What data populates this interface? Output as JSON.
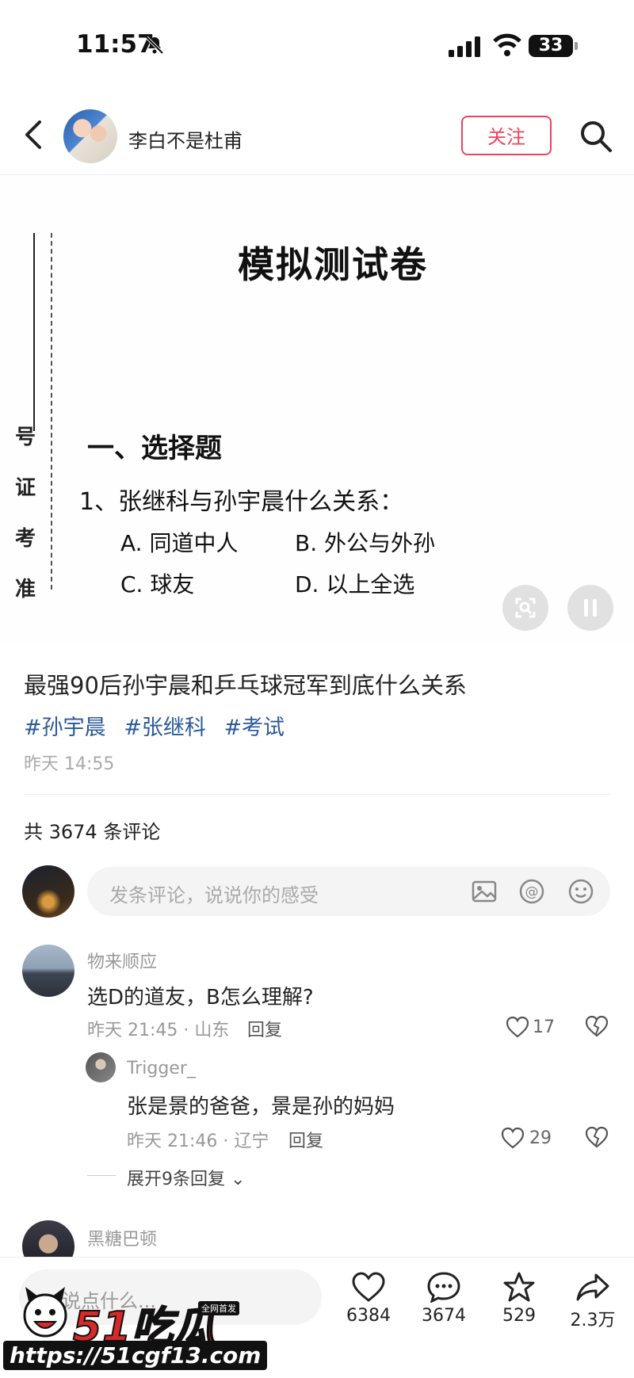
{
  "status_bar": {
    "time": "11:57",
    "battery": "33"
  },
  "header": {
    "username": "李白不是杜甫",
    "follow_label": "关注"
  },
  "exam": {
    "title": "模拟测试卷",
    "vertical_label": [
      "准",
      "考",
      "证",
      "号"
    ],
    "section": "一、选择题",
    "question": "1、张继科与孙宇晨什么关系：",
    "options": [
      "A. 同道中人",
      "B. 外公与外孙",
      "C. 球友",
      "D. 以上全选"
    ]
  },
  "post": {
    "title": "最强90后孙宇晨和乒乓球冠军到底什么关系",
    "tags": [
      "#孙宇晨",
      "#张继科",
      "#考试"
    ],
    "time": "昨天 14:55"
  },
  "comments_section": {
    "count_label": "共 3674 条评论",
    "input_placeholder": "发条评论，说说你的感受"
  },
  "comments": [
    {
      "name": "物来顺应",
      "text": "选D的道友，B怎么理解?",
      "meta": "昨天 21:45 · 山东",
      "reply_label": "回复",
      "likes": "17"
    },
    {
      "name": "Trigger_",
      "text": "张是景的爸爸，景是孙的妈妈",
      "meta": "昨天 21:46 · 辽宁",
      "reply_label": "回复",
      "likes": "29"
    },
    {
      "name": "黑糖巴顿"
    }
  ],
  "expand_label": "展开9条回复",
  "bottom_bar": {
    "input_placeholder": "说点什么...",
    "likes": "6384",
    "comments": "3674",
    "favorites": "529",
    "shares": "2.3万"
  },
  "watermark": {
    "logo": "51吃瓜",
    "badge": "全网首发",
    "url": "https://51cgf13.com"
  },
  "colors": {
    "accent": "#e8455a",
    "tag": "#2b5a9a"
  }
}
